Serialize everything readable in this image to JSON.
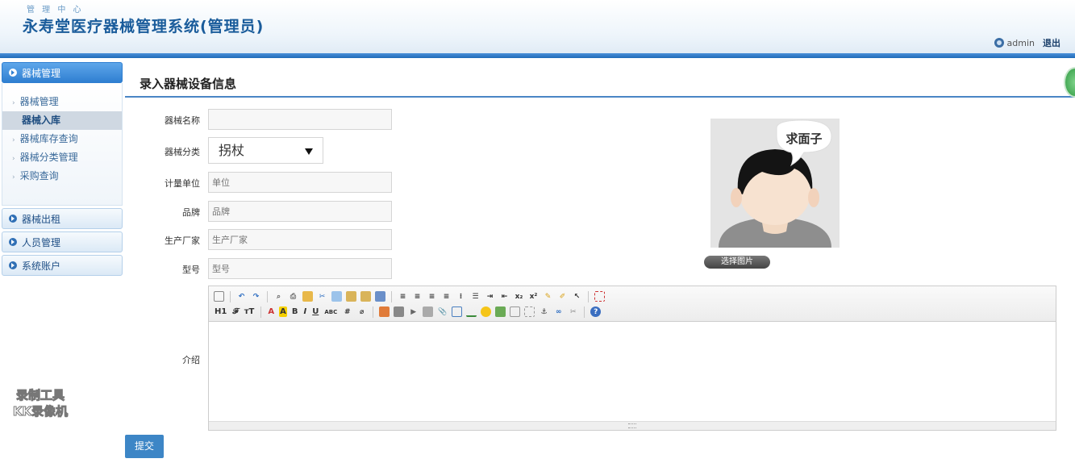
{
  "header": {
    "subtitle": "管 理 中 心",
    "title": "永寿堂医疗器械管理系统(管理员)",
    "username": "admin",
    "logout": "退出"
  },
  "sidebar": {
    "groups": [
      {
        "label": "器械管理",
        "active": true
      },
      {
        "label": "器械出租"
      },
      {
        "label": "人员管理"
      },
      {
        "label": "系统账户"
      }
    ],
    "items": [
      {
        "label": "器械管理"
      },
      {
        "label": "器械入库",
        "selected": true
      },
      {
        "label": "器械库存查询"
      },
      {
        "label": "器械分类管理"
      },
      {
        "label": "采购查询"
      }
    ]
  },
  "watermark": {
    "line1": "录制工具",
    "line2": "KK录像机"
  },
  "main": {
    "title": "录入器械设备信息",
    "form": {
      "name_label": "器械名称",
      "name_placeholder": "",
      "category_label": "器械分类",
      "category_value": "拐杖",
      "unit_label": "计量单位",
      "unit_placeholder": "单位",
      "brand_label": "品牌",
      "brand_placeholder": "品牌",
      "maker_label": "生产厂家",
      "maker_placeholder": "生产厂家",
      "model_label": "型号",
      "model_placeholder": "型号",
      "intro_label": "介绍"
    },
    "avatar_bubble": "求面子",
    "choose_image": "选择图片",
    "submit": "提交"
  },
  "editor": {
    "row2_labels": {
      "h1": "H1",
      "font": "𝓕",
      "size": "тT",
      "fontcolor": "A",
      "bgcolor": "A",
      "bold": "B",
      "italic": "I",
      "underline": "U",
      "strike": "ABC"
    }
  },
  "colors": {
    "accent": "#2f7fd1",
    "title": "#1a5c9b",
    "submit": "#3d86c6"
  }
}
